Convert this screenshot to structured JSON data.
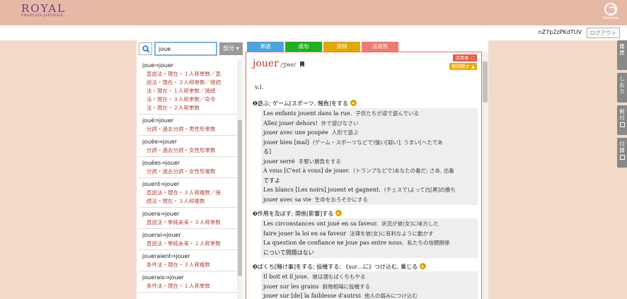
{
  "header": {
    "logo_main": "ROYAL",
    "logo_sub": "FRANÇAIS-JAPONAIS",
    "brand": "Obunsha",
    "user_id": "nZ7p2zPKdTUV",
    "logout_label": "ログアウト"
  },
  "search": {
    "value": "joue",
    "mode_label": "部分 ▾"
  },
  "tabs": [
    {
      "label": "単語",
      "color": "#4aa3df"
    },
    {
      "label": "成句",
      "color": "#20b020"
    },
    {
      "label": "用例",
      "color": "#e0a800"
    },
    {
      "label": "活用形",
      "color": "#f07a72"
    }
  ],
  "results": [
    {
      "head": "joue⇒jouer",
      "lines": [
        "直説法・現在・１人称単数／直",
        "説法・現在・３人称単数／接続",
        "法・現在・１人称単数／接続",
        "法・現在・３人称単数／命令",
        "法・現在・２人称単数"
      ]
    },
    {
      "head": "joué⇒jouer",
      "lines": [
        "分詞・過去分詞・男性形単数"
      ]
    },
    {
      "head": "jouée⇒jouer",
      "lines": [
        "分詞・過去分詞・女性形単数"
      ]
    },
    {
      "head": "jouées⇒jouer",
      "lines": [
        "分詞・過去分詞・女性形複数"
      ]
    },
    {
      "head": "jouent⇒jouer",
      "lines": [
        "直説法・現在・３人称複数／接",
        "続法・現在・３人称複数"
      ]
    },
    {
      "head": "jouera⇒jouer",
      "lines": [
        "直説法・単純未来・３人称単数"
      ]
    },
    {
      "head": "jouerai⇒jouer",
      "lines": [
        "直説法・単純未来・１人称単数"
      ]
    },
    {
      "head": "joueraient⇒jouer",
      "lines": [
        "条件法・現在・３人称複数"
      ]
    },
    {
      "head": "jouerais⇒jouer",
      "lines": [
        "条件法・現在・１人称単数"
      ]
    }
  ],
  "entry": {
    "headword": "jouer",
    "pronunciation": "/ʒwe/",
    "hide_conj": "活用表 ▢",
    "hide_examples": "用例隠す ▲",
    "pos": "v.i.",
    "senses": [
      {
        "num": "❶",
        "title": "遊ぶ; ゲーム[スポーツ, 賭負]をする",
        "examples": [
          {
            "fr": "Les enfants jouent dans la rue.",
            "ja": "子供たちが道で遊んでいる"
          },
          {
            "fr": "Allez jouer dehors!",
            "ja": "外で遊びなさい"
          },
          {
            "fr": "jouer avec une poupée",
            "ja": "人形で遊ぶ"
          },
          {
            "fr": "jouer bien [mal]",
            "ja": "(ゲーム・スポーツなどで)強い[弱い]; うまい[へたであ"
          },
          {
            "fr": "る]",
            "ja": ""
          },
          {
            "fr": "jouer serré",
            "ja": "手堅い勝負をする"
          },
          {
            "fr": "À vous [C'est à vous] de jouer.",
            "ja": "(トランプなどで)あなたの番だ; さあ, 出番"
          },
          {
            "fr": "ですよ",
            "ja": ""
          },
          {
            "fr": "Les blancs [Les noirs] jouent et gagnent.",
            "ja": "(チェスで)よって白[黒]の勝ち"
          },
          {
            "fr": "jouer avec sa vie",
            "ja": "生命をおろそかにする"
          }
        ]
      },
      {
        "num": "❷",
        "title": "作用を及ぼす; 関係[影響]する",
        "examples": [
          {
            "fr": "Les circonstances ont joué en sa faveur.",
            "ja": "状況が彼(女)に味方した"
          },
          {
            "fr": "faire jouer la loi en sa faveur",
            "ja": "法律を彼(女)に有利なように動かす"
          },
          {
            "fr": "La question de confiance ne joue pas entre nous.",
            "ja": "私たちの信頼関係"
          },
          {
            "fr": "について問題はない",
            "ja": ""
          }
        ]
      },
      {
        "num": "❸",
        "title": "ばくち[賭け事]をする; 投機する; 《sur…に》つけ込む, 乗じる",
        "examples": [
          {
            "fr": "Il boit et il joue.",
            "ja": "彼は酒もばくちもやる"
          },
          {
            "fr": "jouer sur les grains",
            "ja": "穀物相場に投機する"
          },
          {
            "fr": "jouer sur [de] la faiblesse d'autrui",
            "ja": "他人の弱みにつけ込む"
          }
        ]
      }
    ]
  },
  "side_tabs": [
    {
      "label": "履歴"
    },
    {
      "label": "しおり"
    },
    {
      "label": "前付"
    },
    {
      "label": "付録"
    }
  ]
}
